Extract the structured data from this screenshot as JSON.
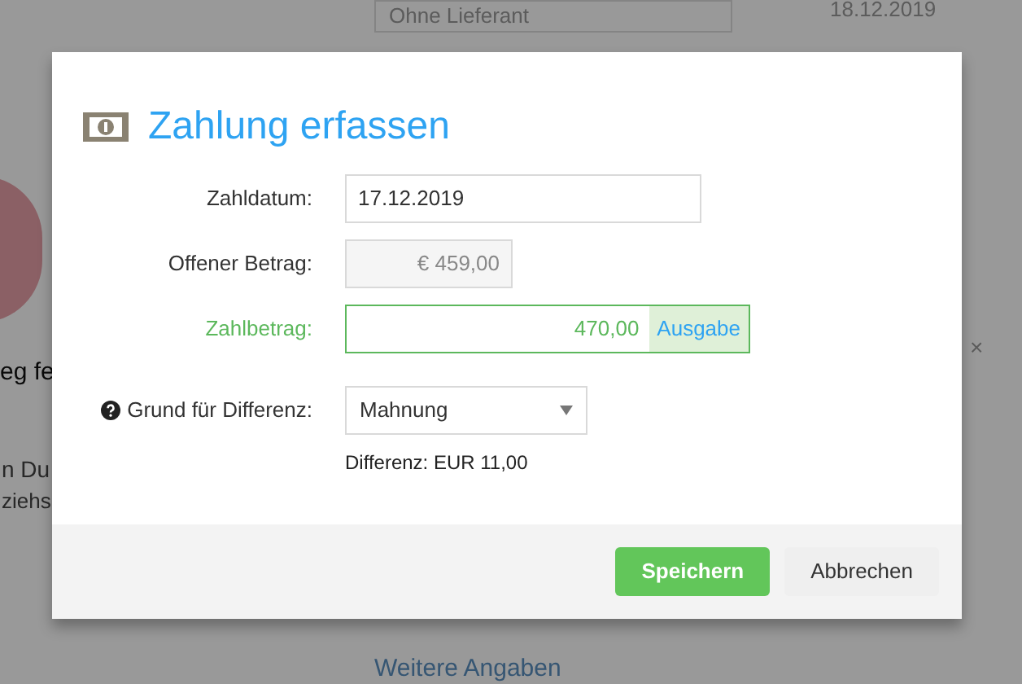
{
  "background": {
    "supplier_select": "Ohne Lieferant",
    "date": "18.12.2019",
    "fragment_1": "eg fe",
    "fragment_2": "n Du",
    "fragment_3": "ziehs",
    "clear_glyph": "×",
    "link": "Weitere Angaben"
  },
  "dialog": {
    "title": "Zahlung erfassen",
    "fields": [
      {
        "kind": "text",
        "label": "Zahldatum:",
        "value": "17.12.2019",
        "highlighted": false,
        "disabled": false
      },
      {
        "kind": "text",
        "label": "Offener Betrag:",
        "value": "€ 459,00",
        "highlighted": false,
        "disabled": true
      },
      {
        "kind": "addon",
        "label": "Zahlbetrag:",
        "value": "470,00",
        "addon": "Ausgabe",
        "highlighted": true,
        "disabled": false
      },
      {
        "kind": "select",
        "label": "Grund für Differenz:",
        "value": "Mahnung",
        "help": true,
        "highlighted": false
      }
    ],
    "difference": "Differenz: EUR 11,00",
    "buttons": [
      {
        "label": "Speichern",
        "kind": "primary"
      },
      {
        "label": "Abbrechen",
        "kind": "secondary"
      }
    ]
  }
}
